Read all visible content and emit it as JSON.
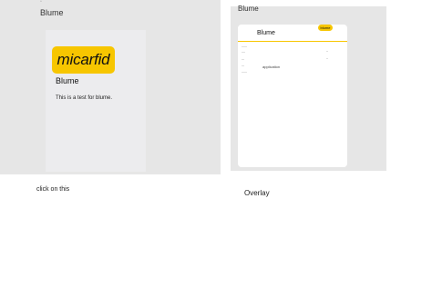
{
  "left": {
    "title": "Blume",
    "logo_text": "micarfid",
    "card_title": "Blume",
    "card_description": "This is a test for blume.",
    "caption": "click on this"
  },
  "right": {
    "title": "Blume",
    "badge_text": "blume",
    "card_title": "Blume",
    "item_label": "application",
    "caption": "Overlay"
  },
  "colors": {
    "accent": "#f7c600",
    "panel_background": "#e6e6e6"
  }
}
